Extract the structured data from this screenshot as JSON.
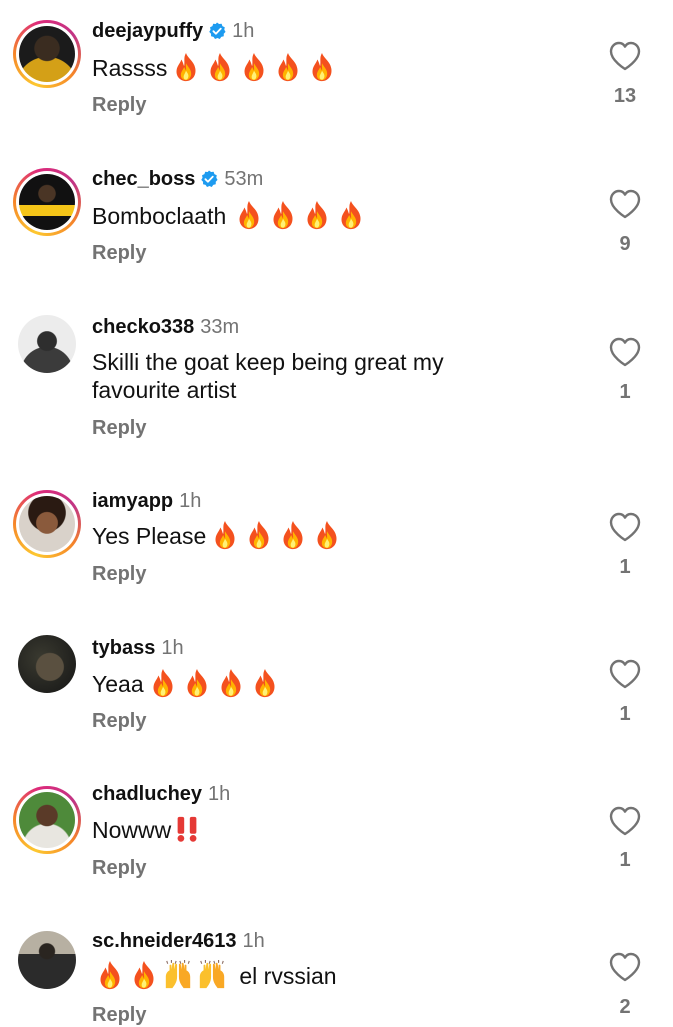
{
  "reply_label": "Reply",
  "colors": {
    "verified": "#1d9bf0",
    "muted": "#737373",
    "text": "#111111"
  },
  "comments": [
    {
      "username": "deejaypuffy",
      "verified": true,
      "time": "1h",
      "text": "Rassss",
      "emojis": [
        "fire-emoji",
        "fire-emoji",
        "fire-emoji",
        "fire-emoji",
        "fire-emoji"
      ],
      "likes": "13",
      "story_ring": true
    },
    {
      "username": "chec_boss",
      "verified": true,
      "time": "53m",
      "text": "Bomboclaath",
      "emojis": [
        "fire-emoji",
        "fire-emoji",
        "fire-emoji",
        "fire-emoji"
      ],
      "likes": "9",
      "story_ring": true
    },
    {
      "username": "checko338",
      "verified": false,
      "time": "33m",
      "text": "Skilli the goat keep being great my favourite artist",
      "emojis": [],
      "likes": "1",
      "story_ring": false
    },
    {
      "username": "iamyapp",
      "verified": false,
      "time": "1h",
      "text": "Yes Please",
      "emojis": [
        "fire-emoji",
        "fire-emoji",
        "fire-emoji",
        "fire-emoji"
      ],
      "likes": "1",
      "story_ring": true
    },
    {
      "username": "tybass",
      "verified": false,
      "time": "1h",
      "text": "Yeaa",
      "emojis": [
        "fire-emoji",
        "fire-emoji",
        "fire-emoji",
        "fire-emoji"
      ],
      "likes": "1",
      "story_ring": false
    },
    {
      "username": "chadluchey",
      "verified": false,
      "time": "1h",
      "text": "Nowww",
      "emojis": [
        "double-exclamation-emoji"
      ],
      "likes": "1",
      "story_ring": true
    },
    {
      "username": "sc.hneider4613",
      "verified": false,
      "time": "1h",
      "text": "el rvssian",
      "emojis_before": [
        "fire-emoji",
        "fire-emoji",
        "raising-hands-emoji",
        "raising-hands-emoji"
      ],
      "likes": "2",
      "story_ring": false
    }
  ]
}
